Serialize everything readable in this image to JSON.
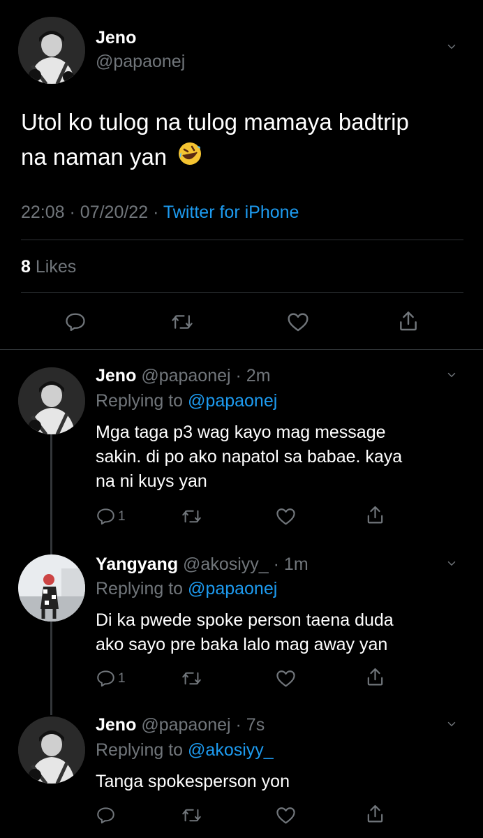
{
  "main_tweet": {
    "author_name": "Jeno",
    "author_handle": "@papaonej",
    "text_line1": "Utol ko tulog na tulog mamaya badtrip",
    "text_line2": "na naman yan",
    "emoji": "🤣",
    "time": "22:08",
    "date": "07/20/22",
    "source": "Twitter for iPhone",
    "likes_count": "8",
    "likes_label": "Likes"
  },
  "replies": [
    {
      "author_name": "Jeno",
      "author_handle": "@papaonej",
      "age": "2m",
      "replying_label": "Replying to",
      "replying_to": "@papaonej",
      "lines": [
        "Mga taga p3 wag kayo mag message",
        "sakin. di po ako napatol sa babae. kaya",
        "na ni kuys yan"
      ],
      "reply_count": "1"
    },
    {
      "author_name": "Yangyang",
      "author_handle": "@akosiyy_",
      "age": "1m",
      "replying_label": "Replying to",
      "replying_to": "@papaonej",
      "lines": [
        "Di ka pwede spoke person taena duda",
        "ako sayo pre baka lalo mag away yan"
      ],
      "reply_count": "1"
    },
    {
      "author_name": "Jeno",
      "author_handle": "@papaonej",
      "age": "7s",
      "replying_label": "Replying to",
      "replying_to": "@akosiyy_",
      "lines": [
        "Tanga spokesperson yon"
      ],
      "reply_count": ""
    }
  ],
  "icons": {
    "reply": "comment-bubble-icon",
    "retweet": "retweet-icon",
    "like": "heart-icon",
    "share": "share-icon",
    "more": "chevron-down-icon"
  },
  "colors": {
    "background": "#000000",
    "text": "#e7e9ea",
    "muted": "#71767b",
    "link": "#1d9bf0",
    "divider": "#2f3336"
  }
}
